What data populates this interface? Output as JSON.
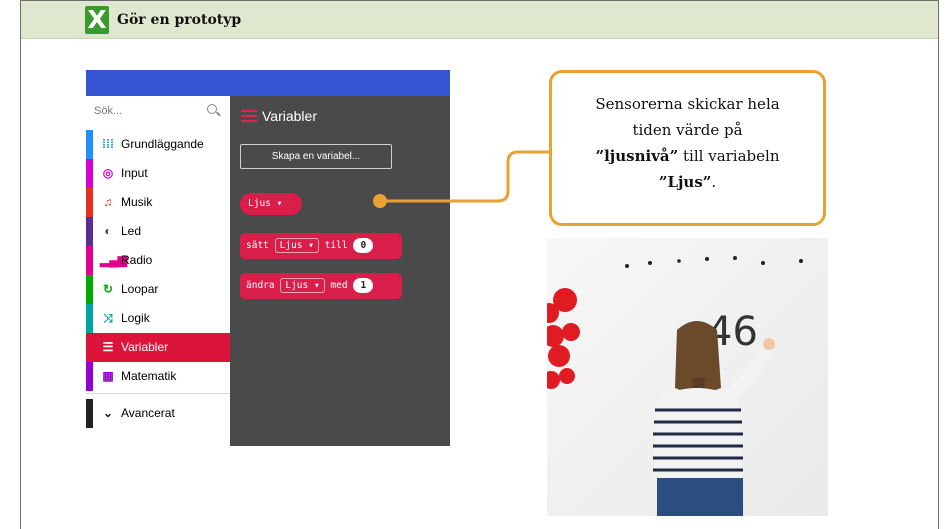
{
  "header": {
    "logo_letter": "X",
    "title": "Gör en prototyp"
  },
  "toolbox": {
    "search_placeholder": "Sök...",
    "categories": [
      {
        "label": "Grundläggande",
        "icon": "grid-icon",
        "icon_glyph": "⁞⁞⁞",
        "color": "#1e90ff"
      },
      {
        "label": "Input",
        "icon": "target-icon",
        "icon_glyph": "◎",
        "color": "#d400d4"
      },
      {
        "label": "Musik",
        "icon": "headphones-icon",
        "icon_glyph": "♫",
        "color": "#e63022"
      },
      {
        "label": "Led",
        "icon": "toggle-icon",
        "icon_glyph": "◐",
        "color": "#5c2d91"
      },
      {
        "label": "Radio",
        "icon": "signal-icon",
        "icon_glyph": "▂▄▆",
        "color": "#e3008c"
      },
      {
        "label": "Loopar",
        "icon": "refresh-icon",
        "icon_glyph": "↻",
        "color": "#00aa00"
      },
      {
        "label": "Logik",
        "icon": "shuffle-icon",
        "icon_glyph": "⤨",
        "color": "#00a4a6"
      },
      {
        "label": "Variabler",
        "icon": "list-icon",
        "icon_glyph": "☰",
        "color": "#dc143c",
        "selected": true
      },
      {
        "label": "Matematik",
        "icon": "calculator-icon",
        "icon_glyph": "▦",
        "color": "#9400d3"
      },
      {
        "label": "Avancerat",
        "icon": "chevron-down-icon",
        "icon_glyph": "⌄",
        "color": "#222222"
      }
    ]
  },
  "workspace": {
    "title": "Variabler",
    "make_variable_button": "Skapa en variabel...",
    "variable_block": {
      "name": "Ljus ▾"
    },
    "set_block": {
      "keyword": "sätt",
      "variable": "Ljus ▾",
      "to": "till",
      "value": "0"
    },
    "change_block": {
      "keyword": "ändra",
      "variable": "Ljus ▾",
      "by": "med",
      "value": "1"
    }
  },
  "callout": {
    "line1": "Sensorerna skickar hela",
    "line2": "tiden värde på",
    "line3_bold": "”ljusnivå”",
    "line3_rest": " till variabeln",
    "line4_bold": "”Ljus”",
    "line4_rest": "."
  },
  "photo": {
    "board_number": "46"
  },
  "colors": {
    "accent_orange": "#e7a233",
    "toolbar_blue": "#3454d1",
    "block_red": "#d91e4a",
    "header_green": "#dfe8cf",
    "logo_green": "#3a9a2e"
  }
}
